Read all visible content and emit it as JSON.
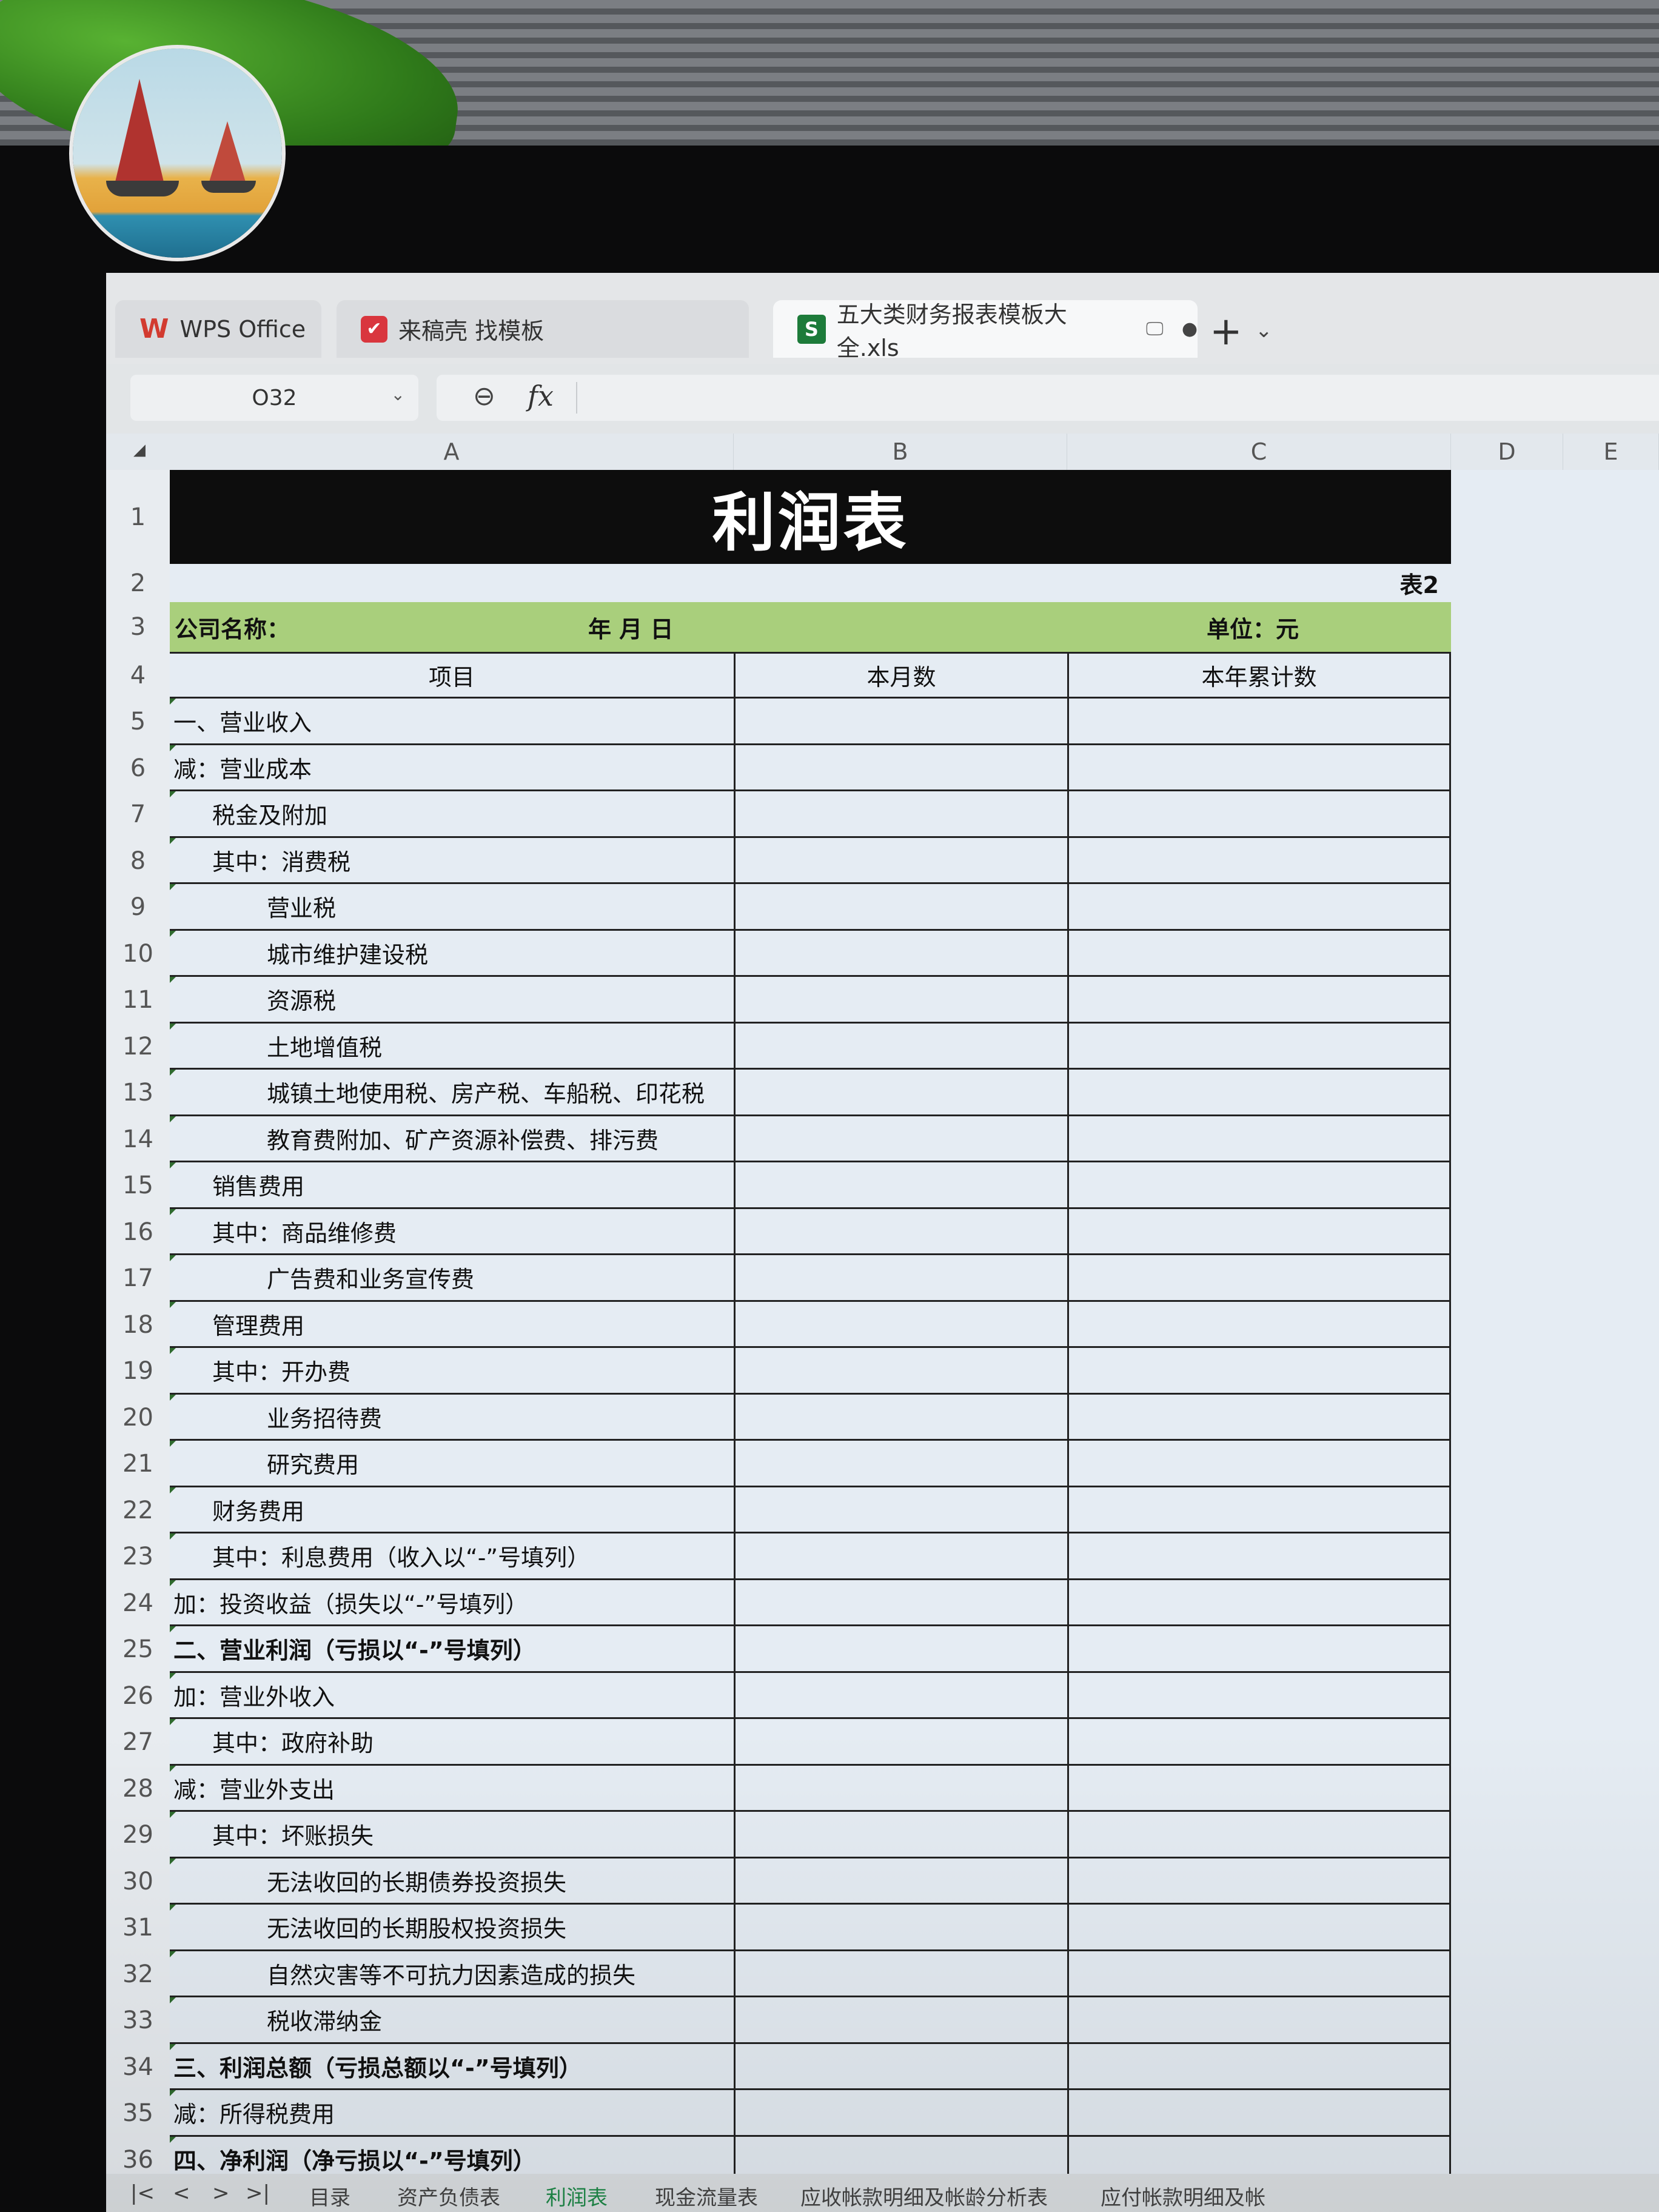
{
  "tabs": [
    {
      "label": "WPS Office",
      "icon": "wps-logo-icon"
    },
    {
      "label": "来稿壳 找模板",
      "icon": "red-template-icon"
    },
    {
      "label": "五大类财务报表模板大全.xls",
      "icon": "spreadsheet-s-icon"
    }
  ],
  "tab_glyphs": {
    "wps": "W",
    "red": "✔",
    "sheet": "S",
    "monitor": "🖵",
    "dot": "●",
    "plus": "+",
    "chev": "⌄"
  },
  "formula_bar": {
    "cell_ref": "O32",
    "fx": "fx",
    "zoom": "⊖",
    "chev": "⌄",
    "formula": ""
  },
  "columns": [
    "A",
    "B",
    "C",
    "D",
    "E"
  ],
  "corner_glyph": "◢",
  "sheet": {
    "title": "利润表",
    "table_no": "表2",
    "company_label": "公司名称：",
    "date_label": "年    月    日",
    "unit_label": "单位：元",
    "headers": [
      "项目",
      "本月数",
      "本年累计数"
    ],
    "items": [
      {
        "row": "5",
        "text": "一、营业收入",
        "indent": 0,
        "bold": false
      },
      {
        "row": "6",
        "text": "减：营业成本",
        "indent": 0,
        "bold": false
      },
      {
        "row": "7",
        "text": "税金及附加",
        "indent": 1,
        "bold": false
      },
      {
        "row": "8",
        "text": "其中：消费税",
        "indent": 1,
        "bold": false
      },
      {
        "row": "9",
        "text": "营业税",
        "indent": 2,
        "bold": false
      },
      {
        "row": "10",
        "text": "城市维护建设税",
        "indent": 2,
        "bold": false
      },
      {
        "row": "11",
        "text": "资源税",
        "indent": 2,
        "bold": false
      },
      {
        "row": "12",
        "text": "土地增值税",
        "indent": 2,
        "bold": false
      },
      {
        "row": "13",
        "text": "城镇土地使用税、房产税、车船税、印花税",
        "indent": 2,
        "bold": false
      },
      {
        "row": "14",
        "text": "教育费附加、矿产资源补偿费、排污费",
        "indent": 2,
        "bold": false
      },
      {
        "row": "15",
        "text": "销售费用",
        "indent": 1,
        "bold": false
      },
      {
        "row": "16",
        "text": "其中：商品维修费",
        "indent": 1,
        "bold": false
      },
      {
        "row": "17",
        "text": "广告费和业务宣传费",
        "indent": 2,
        "bold": false
      },
      {
        "row": "18",
        "text": "管理费用",
        "indent": 1,
        "bold": false
      },
      {
        "row": "19",
        "text": "其中：开办费",
        "indent": 1,
        "bold": false
      },
      {
        "row": "20",
        "text": "业务招待费",
        "indent": 2,
        "bold": false
      },
      {
        "row": "21",
        "text": "研究费用",
        "indent": 2,
        "bold": false
      },
      {
        "row": "22",
        "text": "财务费用",
        "indent": 1,
        "bold": false
      },
      {
        "row": "23",
        "text": "其中：利息费用（收入以“-”号填列）",
        "indent": 1,
        "bold": false
      },
      {
        "row": "24",
        "text": "加：投资收益（损失以“-”号填列）",
        "indent": 0,
        "bold": false
      },
      {
        "row": "25",
        "text": "二、营业利润（亏损以“-”号填列）",
        "indent": 0,
        "bold": true
      },
      {
        "row": "26",
        "text": "加：营业外收入",
        "indent": 0,
        "bold": false
      },
      {
        "row": "27",
        "text": "其中：政府补助",
        "indent": 1,
        "bold": false
      },
      {
        "row": "28",
        "text": "减：营业外支出",
        "indent": 0,
        "bold": false
      },
      {
        "row": "29",
        "text": "其中：坏账损失",
        "indent": 1,
        "bold": false
      },
      {
        "row": "30",
        "text": "无法收回的长期债券投资损失",
        "indent": 2,
        "bold": false
      },
      {
        "row": "31",
        "text": "无法收回的长期股权投资损失",
        "indent": 2,
        "bold": false
      },
      {
        "row": "32",
        "text": "自然灾害等不可抗力因素造成的损失",
        "indent": 2,
        "bold": false
      },
      {
        "row": "33",
        "text": "税收滞纳金",
        "indent": 2,
        "bold": false
      },
      {
        "row": "34",
        "text": "三、利润总额（亏损总额以“-”号填列）",
        "indent": 0,
        "bold": true
      },
      {
        "row": "35",
        "text": "减：所得税费用",
        "indent": 0,
        "bold": false
      },
      {
        "row": "36",
        "text": "四、净利润（净亏损以“-”号填列）",
        "indent": 0,
        "bold": true
      }
    ]
  },
  "sheet_nav": [
    "|<",
    "<",
    ">",
    ">|"
  ],
  "sheet_tabs": [
    "目录",
    "资产负债表",
    "利润表",
    "现金流量表",
    "应收帐款明细及帐龄分析表",
    "应付帐款明细及帐"
  ],
  "active_sheet": "利润表",
  "colors": {
    "title_bg": "#0d0d0d",
    "info_bg": "#a9cf7c",
    "cell_bg": "#e5ecf3",
    "active_tab": "#1f8a4a"
  }
}
